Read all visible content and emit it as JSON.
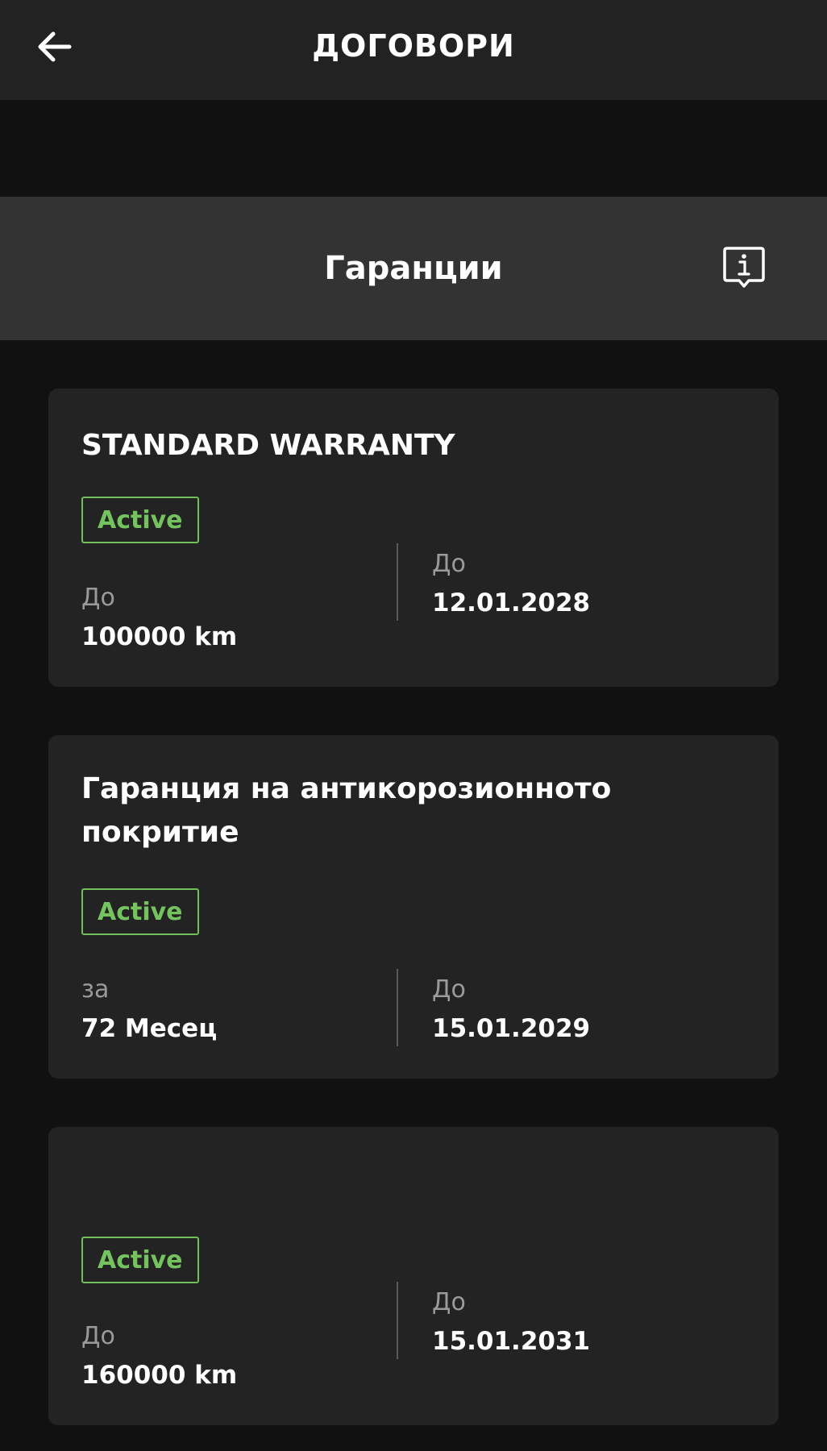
{
  "header": {
    "title": "ДОГОВОРИ",
    "back_icon": "arrow-left-icon"
  },
  "section": {
    "title": "Гаранции",
    "info_icon": "info-icon"
  },
  "colors": {
    "background": "#111111",
    "card": "#232323",
    "active": "#74c35e"
  },
  "warranties": [
    {
      "title": "STANDARD WARRANTY",
      "status": "Active",
      "left_label": "До",
      "left_value": "100000 km",
      "right_label": "До",
      "right_value": "12.01.2028"
    },
    {
      "title": "Гаранция на антикорозионното покритие",
      "status": "Active",
      "left_label": "за",
      "left_value": "72 Месец",
      "right_label": "До",
      "right_value": "15.01.2029"
    },
    {
      "title": "",
      "status": "Active",
      "left_label": "До",
      "left_value": "160000 km",
      "right_label": "До",
      "right_value": "15.01.2031"
    }
  ]
}
